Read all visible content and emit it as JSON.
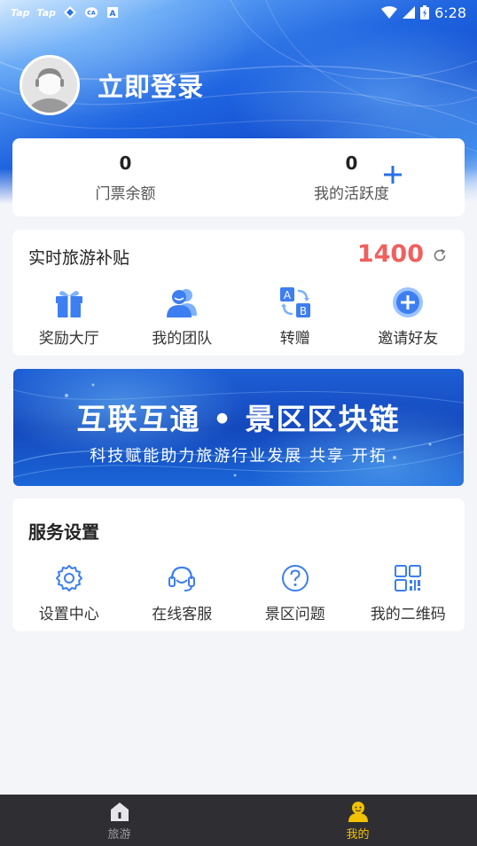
{
  "status_bar": {
    "apps": [
      "Tap",
      "Tap"
    ],
    "time": "6:28",
    "icons": [
      "wifi-icon",
      "signal-icon",
      "battery-icon"
    ]
  },
  "profile": {
    "login_text": "立即登录"
  },
  "stats": {
    "tickets": {
      "value": "0",
      "label": "门票余额"
    },
    "activity": {
      "value": "0",
      "label": "我的活跃度"
    }
  },
  "subsidy": {
    "title": "实时旅游补贴",
    "amount": "1400",
    "items": [
      {
        "label": "奖励大厅",
        "icon": "gift-icon"
      },
      {
        "label": "我的团队",
        "icon": "team-icon"
      },
      {
        "label": "转赠",
        "icon": "transfer-icon"
      },
      {
        "label": "邀请好友",
        "icon": "invite-icon"
      }
    ]
  },
  "banner": {
    "title": "互联互通 • 景区区块链",
    "subtitle": "科技赋能助力旅游行业发展 共享 开拓"
  },
  "service": {
    "title": "服务设置",
    "items": [
      {
        "label": "设置中心",
        "icon": "gear-icon"
      },
      {
        "label": "在线客服",
        "icon": "headset-icon"
      },
      {
        "label": "景区问题",
        "icon": "question-icon"
      },
      {
        "label": "我的二维码",
        "icon": "qrcode-icon"
      }
    ]
  },
  "tabbar": {
    "tabs": [
      {
        "label": "旅游",
        "icon": "home-icon",
        "active": false
      },
      {
        "label": "我的",
        "icon": "user-icon",
        "active": true
      }
    ]
  },
  "colors": {
    "accent_blue": "#3d7ef0",
    "amount_red": "#f0605e",
    "tab_active": "#f2c200"
  }
}
